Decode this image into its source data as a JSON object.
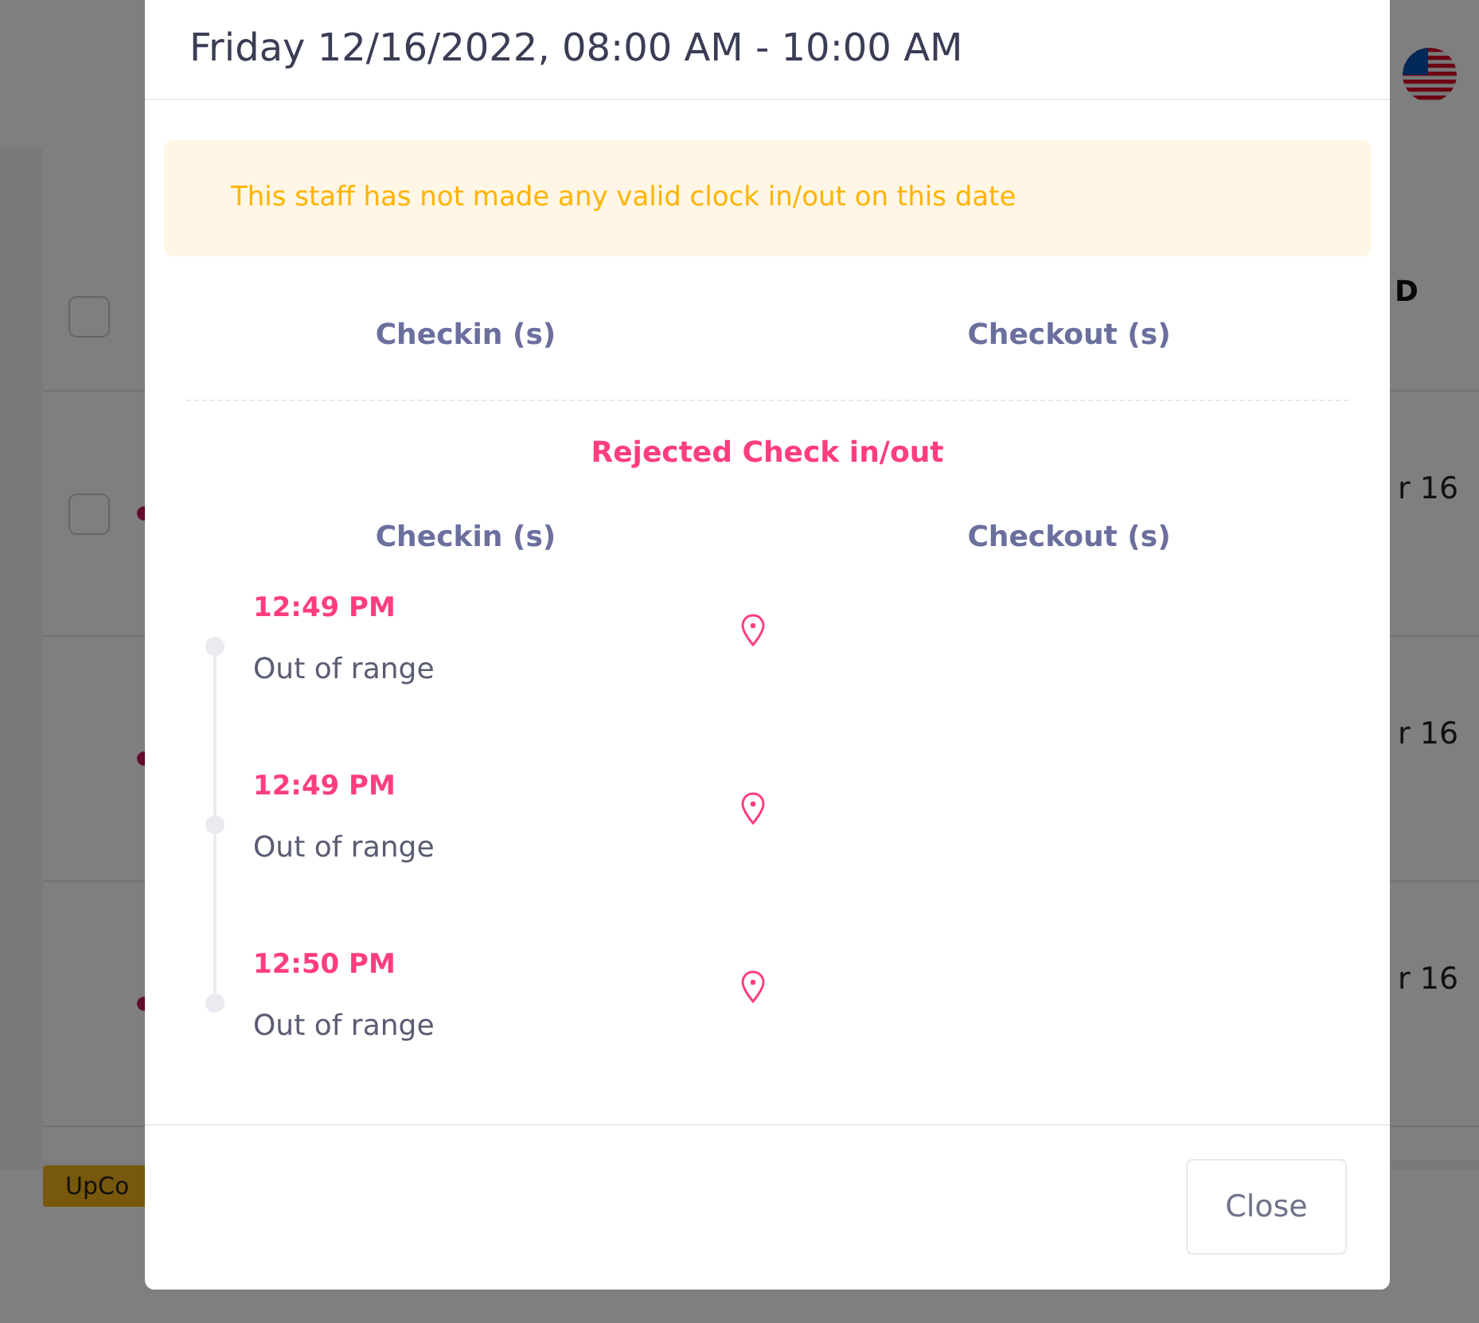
{
  "page": {
    "header_checkbox": {
      "checked": false
    },
    "column_heading_fragment": "D",
    "rows": [
      {
        "checkbox": {
          "checked": false
        },
        "date_fragment": "r 16"
      },
      {
        "date_fragment": "r 16"
      },
      {
        "date_fragment": "r 16"
      }
    ],
    "status_badge": "UpCo"
  },
  "modal": {
    "title": "Friday 12/16/2022, 08:00 AM - 10:00 AM",
    "alert": "This staff has not made any valid clock in/out on this date",
    "valid": {
      "columns": [
        "Checkin (s)",
        "Checkout (s)"
      ]
    },
    "rejected": {
      "heading": "Rejected Check in/out",
      "columns": [
        "Checkin (s)",
        "Checkout (s)"
      ],
      "checkins": [
        {
          "time": "12:49 PM",
          "note": "Out of range"
        },
        {
          "time": "12:49 PM",
          "note": "Out of range"
        },
        {
          "time": "12:50 PM",
          "note": "Out of range"
        }
      ]
    },
    "close_button": "Close"
  }
}
